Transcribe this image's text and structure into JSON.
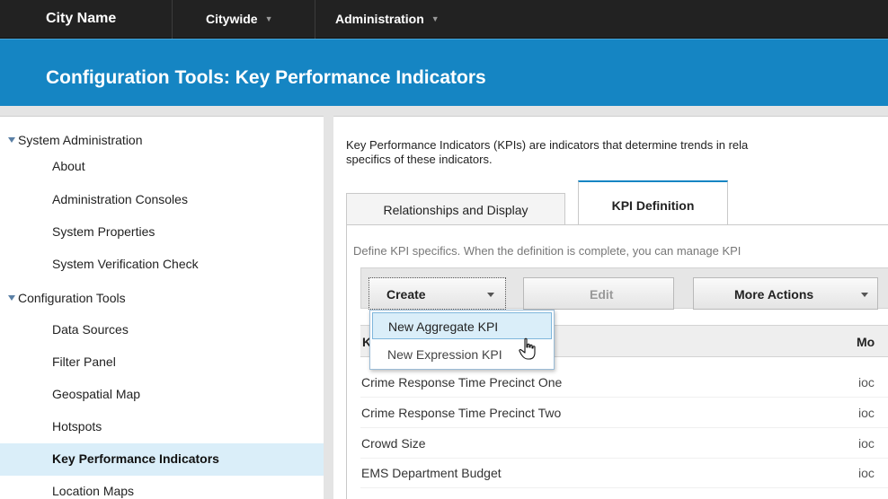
{
  "topbar": {
    "brand": "City Name",
    "menus": [
      {
        "label": "Citywide"
      },
      {
        "label": "Administration"
      }
    ]
  },
  "title": "Configuration Tools: Key Performance Indicators",
  "sidebar": {
    "groups": [
      {
        "label": "System Administration",
        "items": [
          "About",
          "Administration Consoles",
          "System Properties",
          "System Verification Check"
        ]
      },
      {
        "label": "Configuration Tools",
        "items": [
          "Data Sources",
          "Filter Panel",
          "Geospatial Map",
          "Hotspots",
          "Key Performance Indicators",
          "Location Maps"
        ]
      }
    ],
    "active_item": "Key Performance Indicators"
  },
  "main": {
    "intro_line1": "Key Performance Indicators (KPIs) are indicators that determine trends in rela",
    "intro_line2": "specifics of these indicators.",
    "tabs": [
      {
        "label": "Relationships and Display",
        "active": false
      },
      {
        "label": "KPI Definition",
        "active": true
      }
    ],
    "define_text": "Define KPI specifics. When the definition is complete, you can manage KPI",
    "toolbar": {
      "create_label": "Create",
      "edit_label": "Edit",
      "more_label": "More Actions"
    },
    "table": {
      "headers": [
        "K",
        "Mo"
      ],
      "rows": [
        {
          "name": "Crime Response Time Precinct One",
          "model": "ioc"
        },
        {
          "name": "Crime Response Time Precinct Two",
          "model": "ioc"
        },
        {
          "name": "Crowd Size",
          "model": "ioc"
        },
        {
          "name": "EMS Department Budget",
          "model": "ioc"
        }
      ]
    },
    "create_menu": [
      {
        "label": "New Aggregate KPI",
        "highlighted": true
      },
      {
        "label": "New Expression KPI",
        "highlighted": false
      }
    ]
  },
  "colors": {
    "topbar": "#222222",
    "title_band": "#1585c3",
    "active_highlight": "#daeef9"
  },
  "icons": [
    "expand-triangle-icon",
    "dropdown-caret-icon",
    "hand-pointer-cursor-icon"
  ]
}
